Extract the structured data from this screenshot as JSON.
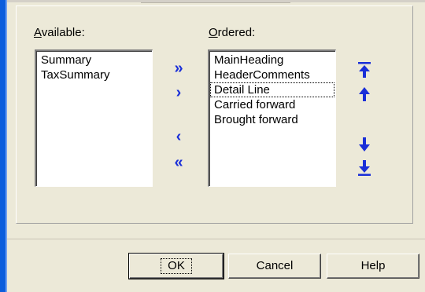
{
  "available": {
    "label_accel": "A",
    "label_rest": "vailable:",
    "items": [
      "Summary",
      "TaxSummary"
    ]
  },
  "ordered": {
    "label_accel": "O",
    "label_rest": "rdered:",
    "items": [
      "MainHeading",
      "HeaderComments",
      "Detail Line",
      "Carried forward",
      "Brought forward"
    ],
    "focused_index": 2
  },
  "move_buttons": {
    "add_all": "»",
    "add": "›",
    "remove": "‹",
    "remove_all": "«"
  },
  "order_buttons": {
    "top_icon": "move-to-top-icon",
    "up_icon": "move-up-icon",
    "down_icon": "move-down-icon",
    "bottom_icon": "move-to-bottom-icon"
  },
  "buttons": {
    "ok": "OK",
    "cancel": "Cancel",
    "help": "Help"
  },
  "colors": {
    "dialog_bg": "#ece9d8",
    "arrow_blue": "#1a2fd8",
    "frame_blue": "#0b5ddc"
  }
}
